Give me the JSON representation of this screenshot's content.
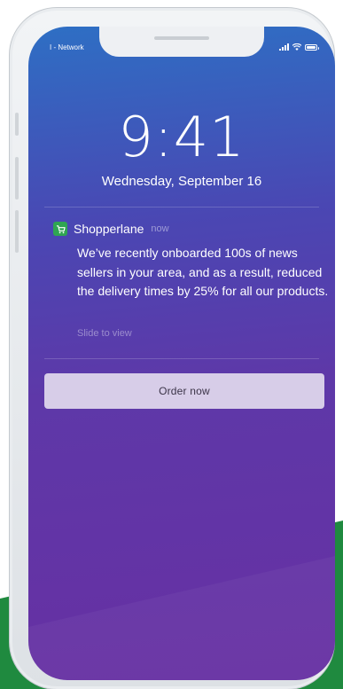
{
  "status_bar": {
    "carrier": "I - Network"
  },
  "lock_screen": {
    "time": "9:41",
    "date": "Wednesday, September 16"
  },
  "notification": {
    "app_icon": "shopping-cart-icon",
    "app_name": "Shopperlane",
    "time": "now",
    "message": "We’ve recently onboarded 100s of news sellers in your area, and as a result, reduced the delivery times by 25% for all our products.",
    "hint": "Slide to view",
    "action_label": "Order now"
  },
  "colors": {
    "app_icon_bg": "#2fa552",
    "action_button_bg": "#d7cde8",
    "background_green": "#1f8a3f"
  }
}
